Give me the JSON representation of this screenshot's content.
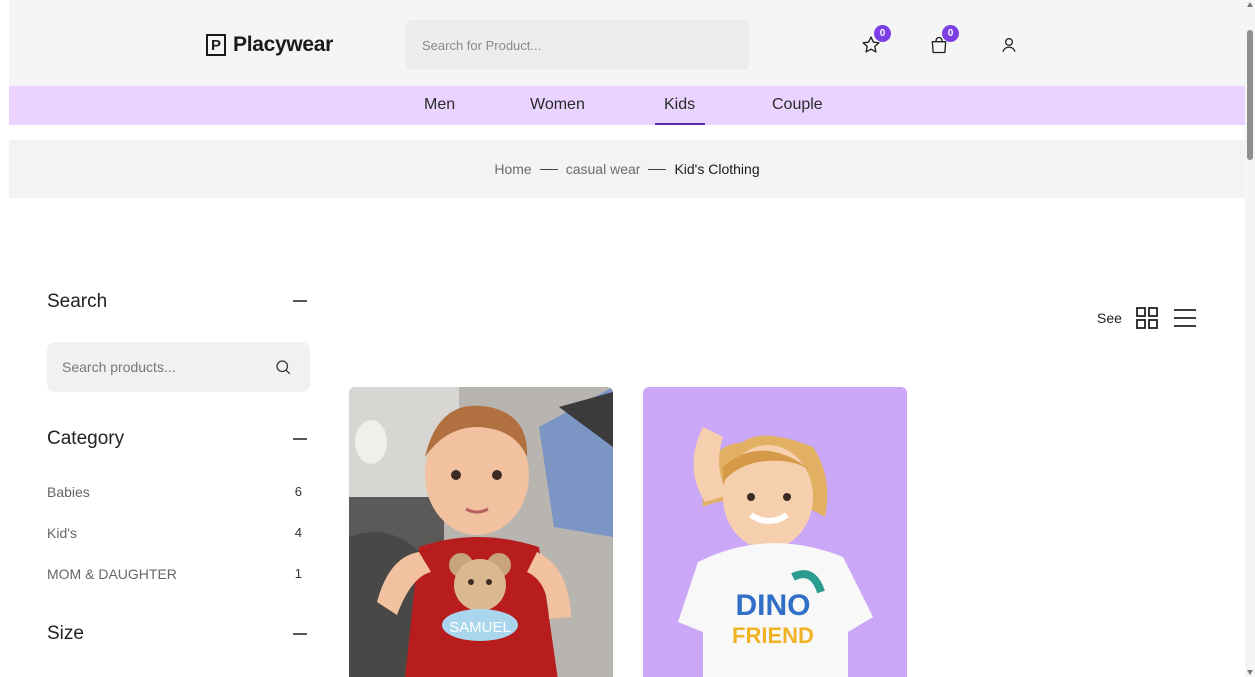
{
  "brand": {
    "logo_letter": "P",
    "name": "Placywear",
    "accent": "#7b3fe4",
    "nav_bg": "#ead3ff"
  },
  "header": {
    "search_placeholder": "Search for Product...",
    "wishlist_count": "0",
    "cart_count": "0",
    "icons": [
      "star-icon",
      "shopping-bag-icon",
      "user-icon"
    ]
  },
  "nav": {
    "items": [
      "Men",
      "Women",
      "Kids",
      "Couple"
    ],
    "active": "Kids"
  },
  "breadcrumb": {
    "home": "Home",
    "parent": "casual wear",
    "current": "Kid's Clothing"
  },
  "sidebar": {
    "search_title": "Search",
    "search_placeholder": "Search products...",
    "category_title": "Category",
    "categories": [
      {
        "label": "Babies",
        "count": "6"
      },
      {
        "label": "Kid's",
        "count": "4"
      },
      {
        "label": "MOM & DAUGHTER",
        "count": "1"
      }
    ],
    "size_title": "Size"
  },
  "view": {
    "label": "See"
  },
  "products": [
    {
      "image_print": "SAMUEL"
    },
    {
      "image_print_line1": "DINO",
      "image_print_line2": "FRIEND"
    }
  ]
}
